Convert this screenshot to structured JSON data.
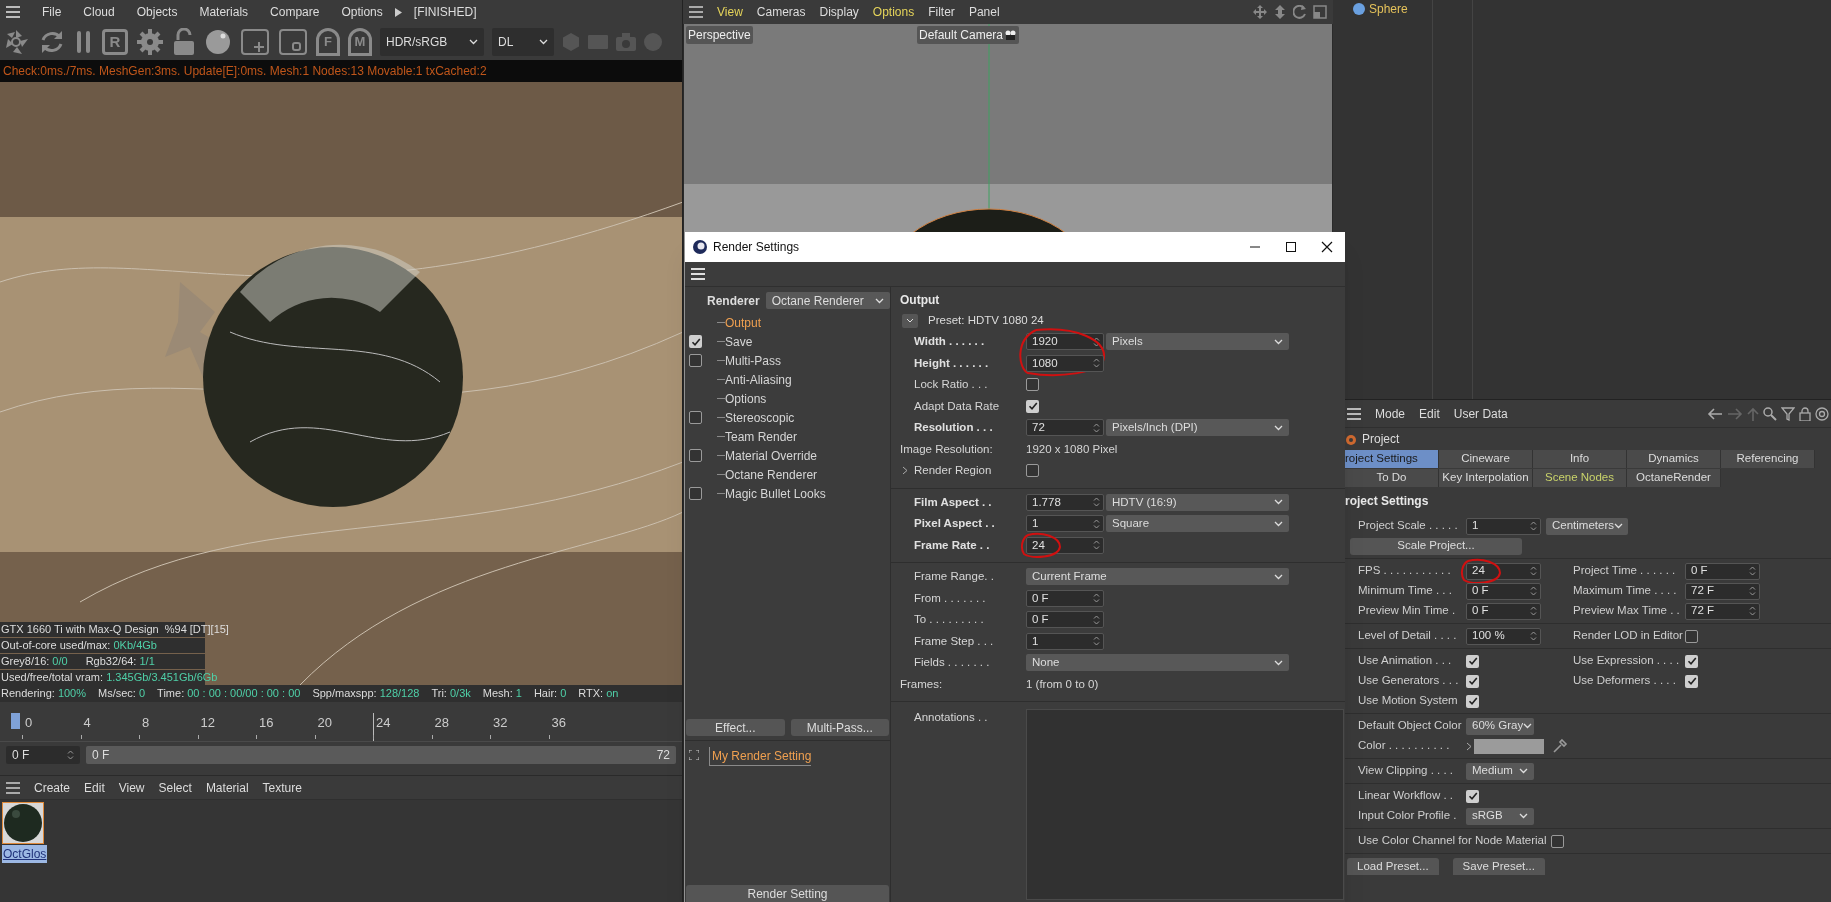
{
  "main_menu": [
    "File",
    "Cloud",
    "Objects",
    "Materials",
    "Compare",
    "Options"
  ],
  "render_state": "[FINISHED]",
  "toolbar": {
    "letters": [
      "R",
      "F",
      "M"
    ],
    "color_space": "HDR/sRGB",
    "mode": "DL"
  },
  "log_line": "Check:0ms./7ms. MeshGen:3ms. Update[E]:0ms. Mesh:1 Nodes:13 Movable:1 txCached:2",
  "gpu": {
    "name": "GTX 1660 Ti with Max-Q Design",
    "info": "%94 [DT][15]"
  },
  "stats": [
    [
      {
        "label": "Out-of-core used/max:",
        "value": "0Kb/4Gb"
      }
    ],
    [
      {
        "label": "Grey8/16:",
        "value": "0/0"
      },
      {
        "label": "Rgb32/64:",
        "value": "1/1"
      }
    ],
    [
      {
        "label": "Used/free/total vram:",
        "value": "1.345Gb/3.451Gb/6Gb"
      }
    ]
  ],
  "render_line": [
    {
      "label": "Rendering:",
      "value": "100%"
    },
    {
      "label": "Ms/sec:",
      "value": "0"
    },
    {
      "label": "Time:",
      "value": "00 : 00 : 00/00 : 00 : 00"
    },
    {
      "label": "Spp/maxspp:",
      "value": "128/128"
    },
    {
      "label": "Tri:",
      "value": "0/3k"
    },
    {
      "label": "Mesh:",
      "value": "1"
    },
    {
      "label": "Hair:",
      "value": "0"
    },
    {
      "label": "RTX:",
      "value": "on"
    }
  ],
  "timeline": {
    "ticks": [
      {
        "label": "0",
        "marked": false
      },
      {
        "label": "4",
        "marked": false
      },
      {
        "label": "8",
        "marked": false
      },
      {
        "label": "12",
        "marked": false
      },
      {
        "label": "16",
        "marked": false
      },
      {
        "label": "20",
        "marked": false
      },
      {
        "label": "24",
        "marked": true
      },
      {
        "label": "28",
        "marked": false
      },
      {
        "label": "32",
        "marked": false
      },
      {
        "label": "36",
        "marked": false
      }
    ],
    "frame": "0 F",
    "range_start": "0 F",
    "range_end": "72"
  },
  "material_menu": [
    "Create",
    "Edit",
    "View",
    "Select",
    "Material",
    "Texture"
  ],
  "materials": [
    {
      "name": "OctGlos",
      "selected": true
    }
  ],
  "viewport": {
    "menu": [
      {
        "label": "View",
        "highlighted": true
      },
      {
        "label": "Cameras",
        "highlighted": false
      },
      {
        "label": "Display",
        "highlighted": false
      },
      {
        "label": "Options",
        "highlighted": true
      },
      {
        "label": "Filter",
        "highlighted": false
      },
      {
        "label": "Panel",
        "highlighted": false
      }
    ],
    "view_name": "Perspective",
    "camera": "Default Camera"
  },
  "object_manager": {
    "object": "Sphere"
  },
  "render_settings": {
    "title": "Render Settings",
    "renderer_label": "Renderer",
    "renderer": "Octane Renderer",
    "items": [
      {
        "label": "Output",
        "selected": true,
        "kind": "plain"
      },
      {
        "label": "Save",
        "selected": false,
        "kind": "toggle",
        "checked": true
      },
      {
        "label": "Multi-Pass",
        "selected": false,
        "kind": "toggle",
        "checked": false
      },
      {
        "label": "Anti-Aliasing",
        "selected": false,
        "kind": "plain"
      },
      {
        "label": "Options",
        "selected": false,
        "kind": "plain"
      },
      {
        "label": "Stereoscopic",
        "selected": false,
        "kind": "toggle",
        "checked": false
      },
      {
        "label": "Team Render",
        "selected": false,
        "kind": "plain"
      },
      {
        "label": "Material Override",
        "selected": false,
        "kind": "toggle",
        "checked": false
      },
      {
        "label": "Octane Renderer",
        "selected": false,
        "kind": "plain"
      },
      {
        "label": "Magic Bullet Looks",
        "selected": false,
        "kind": "toggle",
        "checked": false
      }
    ],
    "buttons": [
      "Effect...",
      "Multi-Pass..."
    ],
    "setting_name": "My Render Setting",
    "bottom_button": "Render Setting",
    "section": "Output",
    "preset": "Preset: HDTV 1080 24",
    "rows": [
      {
        "kind": "number",
        "label": "Width . . . . . .",
        "bold": true,
        "value": "1920",
        "unit": "Pixels",
        "circled": true
      },
      {
        "kind": "number",
        "label": "Height . . . . . .",
        "bold": true,
        "value": "1080",
        "circled": false
      },
      {
        "kind": "checkbox",
        "label": "Lock Ratio . . .",
        "checked": false
      },
      {
        "kind": "checkbox",
        "label": "Adapt Data Rate",
        "checked": true
      },
      {
        "kind": "number",
        "label": "Resolution . . .",
        "bold": true,
        "value": "72",
        "unit": "Pixels/Inch (DPI)",
        "circled": false
      },
      {
        "kind": "info",
        "label": "Image Resolution:",
        "value": "1920 x 1080 Pixel"
      },
      {
        "kind": "group",
        "label": "Render Region",
        "checked": false,
        "expanded": false
      },
      {
        "kind": "divider"
      },
      {
        "kind": "number",
        "label": "Film Aspect . .",
        "bold": true,
        "value": "1.778",
        "unit": "HDTV (16:9)",
        "circled": false
      },
      {
        "kind": "number",
        "label": "Pixel Aspect . .",
        "bold": true,
        "value": "1",
        "unit": "Square",
        "circled": false
      },
      {
        "kind": "number",
        "label": "Frame Rate . .",
        "bold": true,
        "value": "24",
        "circled": true
      },
      {
        "kind": "divider"
      },
      {
        "kind": "select",
        "label": "Frame Range. .",
        "value": "Current Frame"
      },
      {
        "kind": "number",
        "label": "From . . . . . . .",
        "bold": false,
        "value": "0 F",
        "circled": false
      },
      {
        "kind": "number",
        "label": "To . . . . . . . . .",
        "bold": false,
        "value": "0 F",
        "circled": false
      },
      {
        "kind": "number",
        "label": "Frame Step . . .",
        "bold": false,
        "value": "1",
        "circled": false
      },
      {
        "kind": "select",
        "label": "Fields . . . . . . .",
        "value": "None"
      },
      {
        "kind": "info",
        "label": "Frames:",
        "value": "1 (from 0 to 0)"
      },
      {
        "kind": "divider"
      },
      {
        "kind": "textarea",
        "label": "Annotations . ."
      }
    ]
  },
  "attributes": {
    "menu": [
      "Mode",
      "Edit",
      "User Data"
    ],
    "object": "Project",
    "tabs": [
      [
        {
          "label": "roject Settings",
          "selected": true,
          "highlighted": false
        },
        {
          "label": "Cineware",
          "selected": false,
          "highlighted": false
        },
        {
          "label": "Info",
          "selected": false,
          "highlighted": false
        },
        {
          "label": "Dynamics",
          "selected": false,
          "highlighted": false
        },
        {
          "label": "Referencing",
          "selected": false,
          "highlighted": false
        }
      ],
      [
        {
          "label": "To Do",
          "selected": false,
          "highlighted": false
        },
        {
          "label": "Key Interpolation",
          "selected": false,
          "highlighted": false
        },
        {
          "label": "Scene Nodes",
          "selected": false,
          "highlighted": true
        },
        {
          "label": "OctaneRender",
          "selected": false,
          "highlighted": false
        }
      ]
    ],
    "heading": "roject Settings",
    "groups": [
      [
        [
          {
            "kind": "number",
            "label": "Project Scale . . . . .",
            "value": "1",
            "unit": "Centimeters",
            "circled": false
          }
        ],
        [
          {
            "kind": "button",
            "label": "Scale Project..."
          }
        ]
      ],
      [
        [
          {
            "kind": "number",
            "label": "FPS . . . . . . . . . . .",
            "value": "24",
            "circled": true
          },
          {
            "kind": "number",
            "label": "Project Time . . . . . .",
            "value": "0 F",
            "circled": false
          }
        ],
        [
          {
            "kind": "number",
            "label": "Minimum Time . . .",
            "value": "0 F",
            "circled": false
          },
          {
            "kind": "number",
            "label": "Maximum Time . . . .",
            "value": "72 F",
            "circled": false
          }
        ],
        [
          {
            "kind": "number",
            "label": "Preview Min Time .",
            "value": "0 F",
            "circled": false
          },
          {
            "kind": "number",
            "label": "Preview Max Time . .",
            "value": "72 F",
            "circled": false
          }
        ]
      ],
      [
        [
          {
            "kind": "number",
            "label": "Level of Detail . . . .",
            "value": "100 %",
            "circled": false
          },
          {
            "kind": "checkbox",
            "label": "Render LOD in Editor",
            "checked": false
          }
        ]
      ],
      [
        [
          {
            "kind": "checkbox",
            "label": "Use Animation . . .",
            "checked": true
          },
          {
            "kind": "checkbox",
            "label": "Use Expression . . . .",
            "checked": true
          }
        ],
        [
          {
            "kind": "checkbox",
            "label": "Use Generators . . .",
            "checked": true
          },
          {
            "kind": "checkbox",
            "label": "Use Deformers . . . .",
            "checked": true
          }
        ],
        [
          {
            "kind": "checkbox",
            "label": "Use Motion System",
            "checked": true
          }
        ]
      ],
      [
        [
          {
            "kind": "select",
            "label": "Default Object Color",
            "value": "60% Gray"
          }
        ],
        [
          {
            "kind": "color",
            "label": "Color . . . . . . . . . ."
          }
        ]
      ],
      [
        [
          {
            "kind": "select",
            "label": "View Clipping . . . .",
            "value": "Medium"
          }
        ]
      ],
      [
        [
          {
            "kind": "checkbox",
            "label": "Linear Workflow . .",
            "checked": true
          }
        ],
        [
          {
            "kind": "select",
            "label": "Input Color Profile .",
            "value": "sRGB"
          }
        ]
      ],
      [
        [
          {
            "kind": "checkbox",
            "label": "Use Color Channel for Node Material",
            "checked": false
          }
        ]
      ]
    ],
    "buttons": [
      "Load Preset...",
      "Save Preset..."
    ]
  }
}
